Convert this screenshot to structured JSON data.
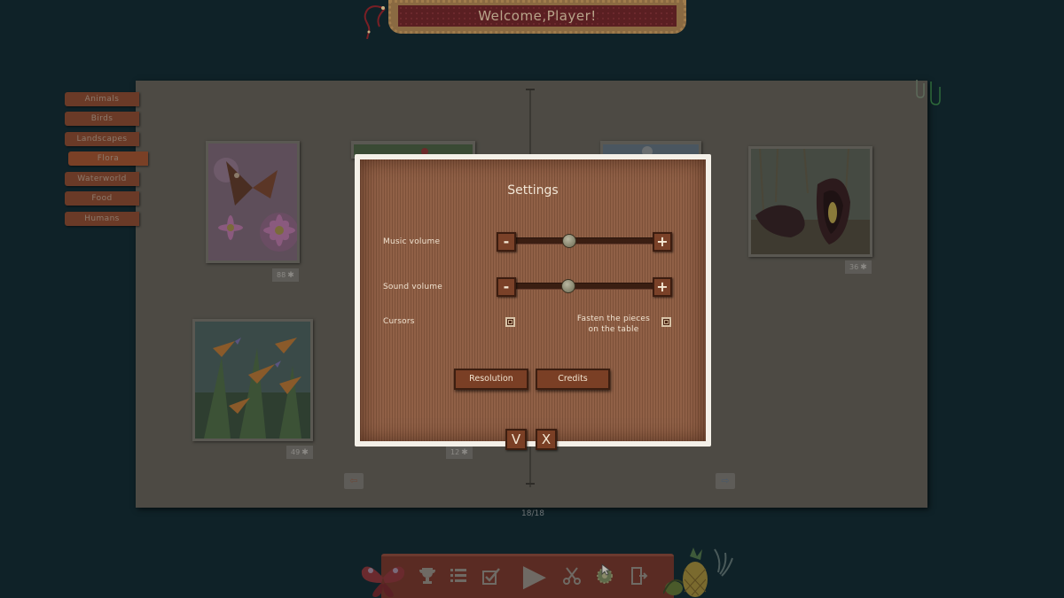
{
  "header": {
    "welcome_text": "Welcome,Player!"
  },
  "categories": [
    {
      "label": "Animals"
    },
    {
      "label": "Birds"
    },
    {
      "label": "Landscapes"
    },
    {
      "label": "Flora",
      "active": true
    },
    {
      "label": "Waterworld"
    },
    {
      "label": "Food"
    },
    {
      "label": "Humans"
    }
  ],
  "puzzles": [
    {
      "subject": "butterfly on asters",
      "count": "88"
    },
    {
      "subject": "bird of paradise flowers",
      "count": "49"
    },
    {
      "subject": "dark calla lily",
      "count": "36"
    },
    {
      "subject": "partially hidden flora",
      "count": "12"
    }
  ],
  "pager": {
    "page": "18/18"
  },
  "settings": {
    "title": "Settings",
    "music_volume_label": "Music volume",
    "music_volume": 0.38,
    "sound_volume_label": "Sound volume",
    "sound_volume": 0.37,
    "cursors_label": "Cursors",
    "fasten_label_line1": "Fasten the pieces",
    "fasten_label_line2": "on the table",
    "minus": "-",
    "plus": "+",
    "resolution_label": "Resolution",
    "credits_label": "Credits",
    "confirm_glyph": "V",
    "close_glyph": "X"
  },
  "toolbar": {
    "icons": [
      "trophy-icon",
      "list-icon",
      "checkbox-icon",
      "play-icon",
      "scissors-icon",
      "gear-icon",
      "exit-icon"
    ],
    "play_glyph": "▶"
  },
  "colors": {
    "background": "#0f2228",
    "board": "#4d4a44",
    "dialog_wood": "#8b5a3f",
    "button_brown": "#7a3f25",
    "tab_brown": "#6a3a27"
  }
}
